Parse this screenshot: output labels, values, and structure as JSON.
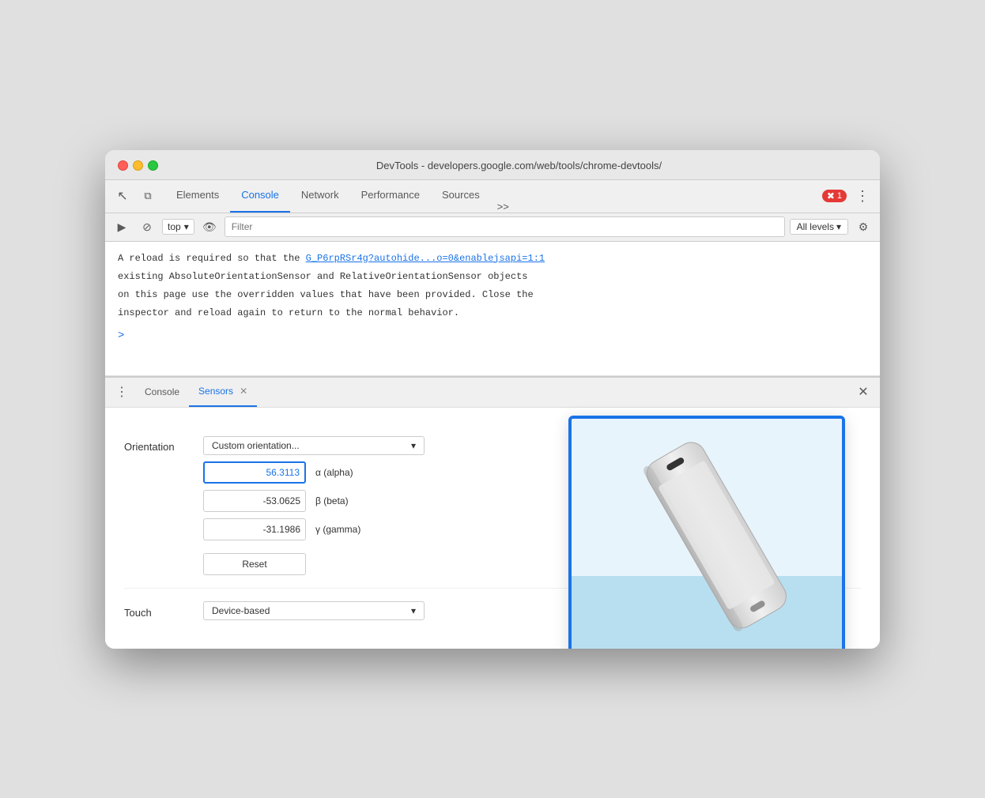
{
  "window": {
    "title": "DevTools - developers.google.com/web/tools/chrome-devtools/"
  },
  "toolbar": {
    "tabs": [
      {
        "id": "elements",
        "label": "Elements",
        "active": false
      },
      {
        "id": "console",
        "label": "Console",
        "active": true
      },
      {
        "id": "network",
        "label": "Network",
        "active": false
      },
      {
        "id": "performance",
        "label": "Performance",
        "active": false
      },
      {
        "id": "sources",
        "label": "Sources",
        "active": false
      }
    ],
    "more_label": ">>",
    "error_count": "1",
    "more_menu": "⋮"
  },
  "console_toolbar": {
    "context": "top",
    "filter_placeholder": "Filter",
    "levels": "All levels"
  },
  "console_output": {
    "message": "A reload is required so that the",
    "link": "G_P6rpRSr4g?autohide...o=0&enablejsapi=1:1",
    "message2": "existing AbsoluteOrientationSensor and RelativeOrientationSensor objects",
    "message3": "on this page use the overridden values that have been provided. Close the",
    "message4": "inspector and reload again to return to the normal behavior."
  },
  "bottom_panel": {
    "tabs": [
      {
        "id": "console",
        "label": "Console",
        "active": false,
        "closeable": false
      },
      {
        "id": "sensors",
        "label": "Sensors",
        "active": true,
        "closeable": true
      }
    ]
  },
  "sensors": {
    "orientation_label": "Orientation",
    "orientation_dropdown": "Custom orientation...",
    "alpha_value": "56.3113",
    "alpha_label": "α (alpha)",
    "beta_value": "-53.0625",
    "beta_label": "β (beta)",
    "gamma_value": "-31.1986",
    "gamma_label": "γ (gamma)",
    "reset_label": "Reset",
    "touch_label": "Touch",
    "touch_dropdown": "Device-based"
  },
  "icons": {
    "cursor": "↖",
    "device": "⧉",
    "play": "▶",
    "no": "⊘",
    "eye": "👁",
    "settings": "⚙",
    "chevron_down": "▾",
    "close": "✕",
    "more_vert": "⋮",
    "spinner": "⟳"
  }
}
